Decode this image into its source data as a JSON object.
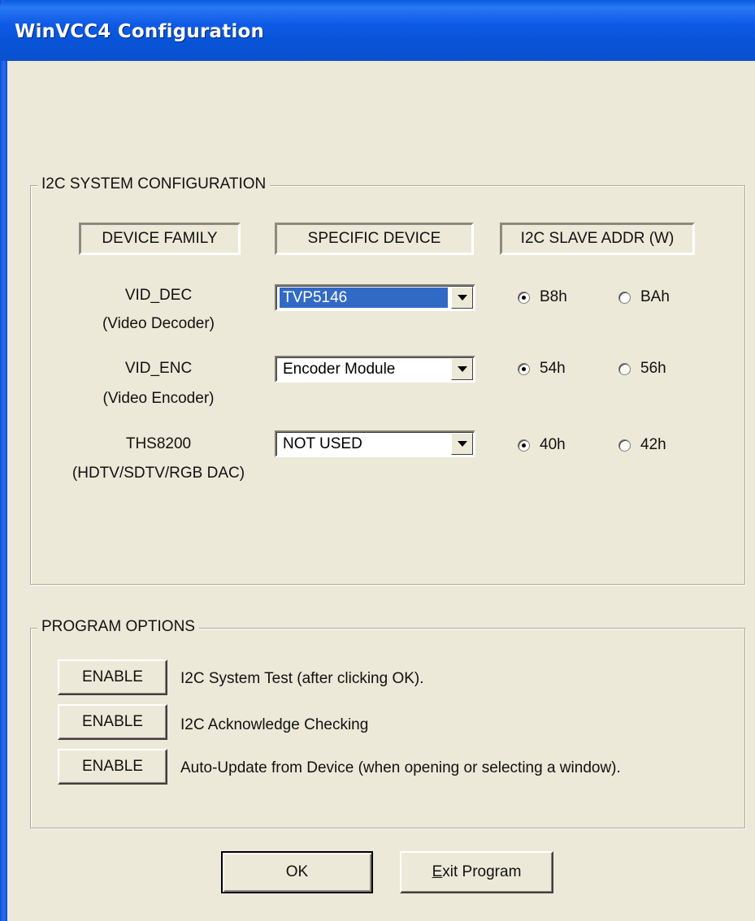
{
  "window": {
    "title": "WinVCC4 Configuration"
  },
  "i2c_group": {
    "legend": "I2C SYSTEM CONFIGURATION",
    "headers": [
      "DEVICE FAMILY",
      "SPECIFIC DEVICE",
      "I2C SLAVE ADDR (W)"
    ],
    "rows": [
      {
        "name": "VID_DEC",
        "desc": "(Video Decoder)",
        "device": "TVP5146",
        "selected_highlight": true,
        "addr_options": [
          "B8h",
          "BAh"
        ],
        "addr_selected": "B8h"
      },
      {
        "name": "VID_ENC",
        "desc": "(Video Encoder)",
        "device": "Encoder Module",
        "selected_highlight": false,
        "addr_options": [
          "54h",
          "56h"
        ],
        "addr_selected": "54h"
      },
      {
        "name": "THS8200",
        "desc": "(HDTV/SDTV/RGB DAC)",
        "device": "NOT USED",
        "selected_highlight": false,
        "addr_options": [
          "40h",
          "42h"
        ],
        "addr_selected": "40h"
      }
    ]
  },
  "program_options": {
    "legend": "PROGRAM OPTIONS",
    "options": [
      {
        "button": "ENABLE",
        "text": "I2C System Test (after clicking OK)."
      },
      {
        "button": "ENABLE",
        "text": "I2C Acknowledge Checking"
      },
      {
        "button": "ENABLE",
        "text": "Auto-Update from Device (when opening or selecting a window)."
      }
    ]
  },
  "footer": {
    "ok_label": "OK",
    "exit_label_mnemonic": "E",
    "exit_label_rest": "xit Program"
  },
  "colors": {
    "titlebar": "#0a5ae0",
    "face": "#ece9d8",
    "selection": "#316ac5"
  }
}
